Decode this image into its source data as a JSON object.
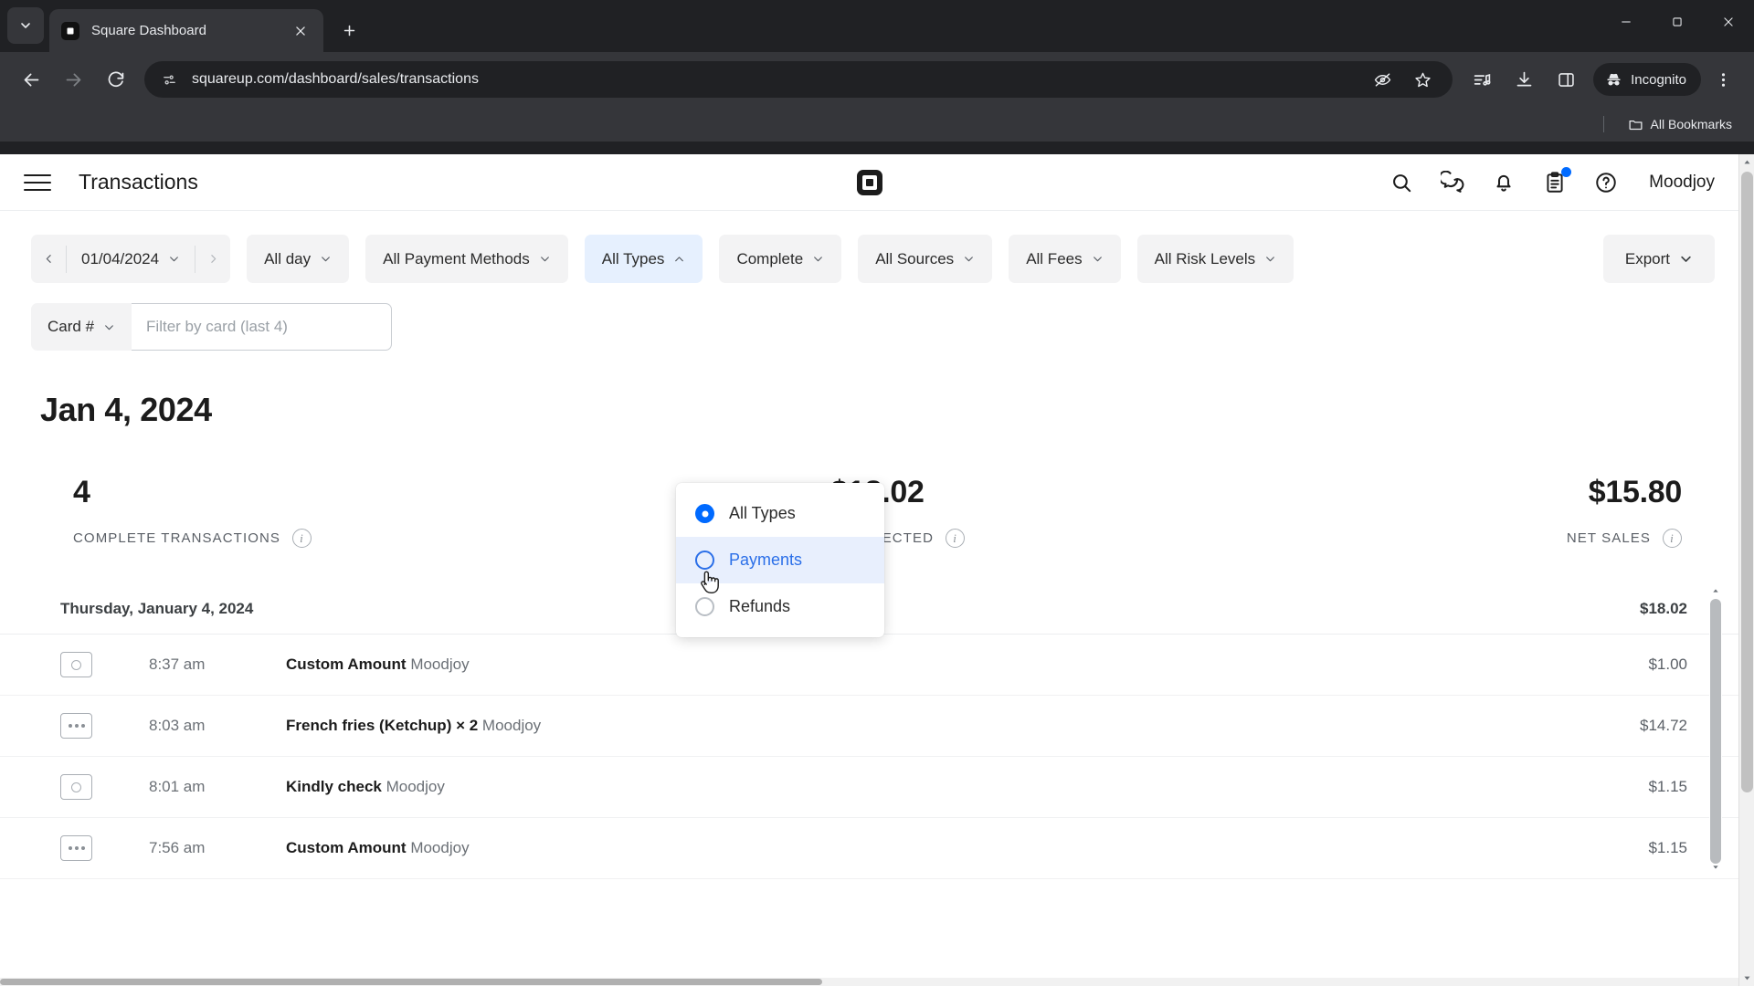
{
  "browser": {
    "tab": {
      "title": "Square Dashboard",
      "favicon_icon": "square-logo-icon",
      "close_icon": "close-icon"
    },
    "tab_list_icon": "chevron-down-icon",
    "new_tab_icon": "plus-icon",
    "window_controls": {
      "minimize": "minimize-icon",
      "maximize": "maximize-icon",
      "close": "close-icon"
    },
    "nav": {
      "back_icon": "back-arrow-icon",
      "forward_icon": "forward-arrow-icon",
      "reload_icon": "reload-icon"
    },
    "omnibox": {
      "site_info_icon": "page-info-icon",
      "url": "squareup.com/dashboard/sales/transactions",
      "tracking_icon": "eye-off-icon",
      "bookmark_icon": "star-icon"
    },
    "actions": {
      "media_icon": "media-list-icon",
      "downloads_icon": "download-icon",
      "sidepanel_icon": "side-panel-icon",
      "incognito_label": "Incognito",
      "incognito_icon": "incognito-icon",
      "menu_icon": "three-dot-menu-icon"
    },
    "bookmarks_bar": {
      "label": "All Bookmarks",
      "icon": "folder-icon"
    }
  },
  "app": {
    "header": {
      "menu_icon": "hamburger-menu-icon",
      "title": "Transactions",
      "logo_icon": "square-logo-icon",
      "icons": [
        {
          "name": "search-icon"
        },
        {
          "name": "messages-icon"
        },
        {
          "name": "notifications-bell-icon"
        },
        {
          "name": "clipboard-tasks-icon",
          "badge": true
        },
        {
          "name": "help-circle-icon"
        }
      ],
      "user": "Moodjoy"
    },
    "filters": {
      "prev_icon": "chevron-left-icon",
      "next_icon": "chevron-right-icon",
      "date": "01/04/2024",
      "chips": [
        {
          "label": "All day",
          "state": "default",
          "chevron": "down"
        },
        {
          "label": "All Payment Methods",
          "state": "default",
          "chevron": "down"
        },
        {
          "label": "All Types",
          "state": "active",
          "chevron": "up"
        },
        {
          "label": "Complete",
          "state": "default",
          "chevron": "down"
        },
        {
          "label": "All Sources",
          "state": "default",
          "chevron": "down"
        },
        {
          "label": "All Fees",
          "state": "default",
          "chevron": "down"
        },
        {
          "label": "All Risk Levels",
          "state": "default",
          "chevron": "down"
        }
      ],
      "export_label": "Export"
    },
    "card_filter": {
      "select_label": "Card #",
      "input_value": "",
      "input_placeholder": "Filter by card (last 4)"
    },
    "types_dropdown": {
      "options": [
        {
          "label": "All Types",
          "selected": true,
          "hovered": false
        },
        {
          "label": "Payments",
          "selected": false,
          "hovered": true
        },
        {
          "label": "Refunds",
          "selected": false,
          "hovered": false
        }
      ]
    },
    "page_date_heading": "Jan 4, 2024",
    "stats": [
      {
        "value": "4",
        "label": "COMPLETE TRANSACTIONS",
        "info_icon": "info-icon"
      },
      {
        "value": "$18.02",
        "label": "TOTAL COLLECTED",
        "info_icon": "info-icon"
      },
      {
        "value": "$15.80",
        "label": "NET SALES",
        "info_icon": "info-icon"
      }
    ],
    "transactions": {
      "group_header": {
        "label": "Thursday, January 4, 2024",
        "total": "$18.02"
      },
      "rows": [
        {
          "icon": "cash-bill-icon",
          "time": "8:37 am",
          "description": "Custom Amount",
          "source": "Moodjoy",
          "amount": "$1.00"
        },
        {
          "icon": "other-dots-icon",
          "time": "8:03 am",
          "description": "French fries (Ketchup) × 2",
          "source": "Moodjoy",
          "amount": "$14.72"
        },
        {
          "icon": "cash-bill-icon",
          "time": "8:01 am",
          "description": "Kindly check",
          "source": "Moodjoy",
          "amount": "$1.15"
        },
        {
          "icon": "other-dots-icon",
          "time": "7:56 am",
          "description": "Custom Amount",
          "source": "Moodjoy",
          "amount": "$1.15"
        }
      ]
    },
    "colors": {
      "accent_blue": "#006aff",
      "hover_blue_bg": "#e8effd",
      "active_chip_bg": "#e6f0fe",
      "chip_bg": "#f3f3f4",
      "text_primary": "#1c1c1c",
      "text_muted": "#6b7076"
    }
  }
}
